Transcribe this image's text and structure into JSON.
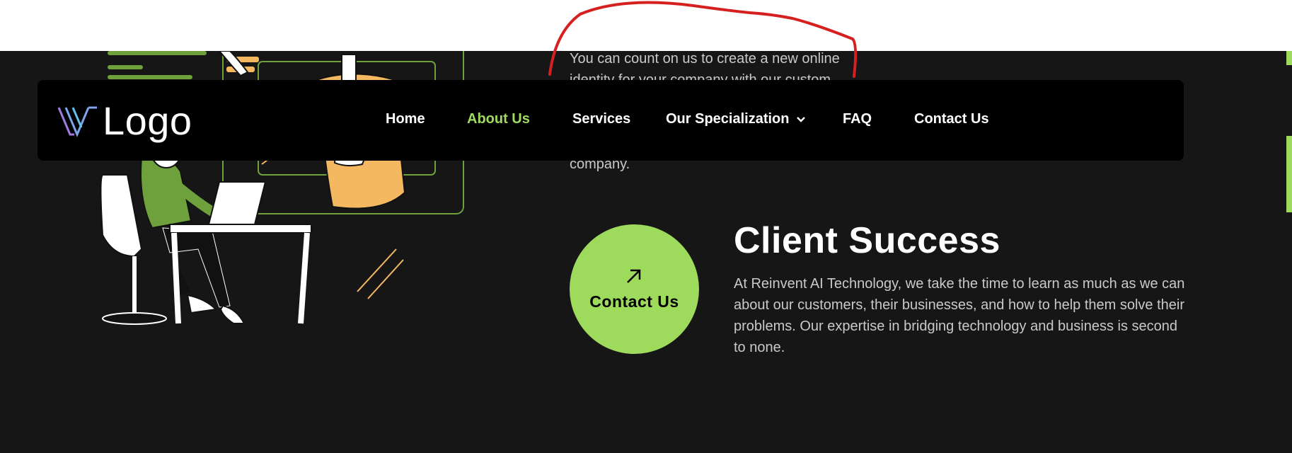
{
  "intro": {
    "text": "You can count on us to create a new online identity for your company with our custom",
    "tail": "company."
  },
  "navbar": {
    "logo_text": "Logo",
    "items": [
      {
        "label": "Home"
      },
      {
        "label": "About Us",
        "active": true
      },
      {
        "label": "Services"
      },
      {
        "label": "Our Specialization"
      },
      {
        "label": "FAQ"
      },
      {
        "label": "Contact Us"
      }
    ]
  },
  "cta": {
    "label": "Contact Us",
    "icon": "arrow-up-right-icon"
  },
  "section": {
    "title": "Client Success",
    "body": "At Reinvent AI Technology, we take the time to learn as much as we can about our customers, their businesses, and how to help them solve their problems. Our expertise in bridging technology and business is second to none."
  },
  "colors": {
    "accent": "#9edb5c",
    "background": "#161616",
    "navbar": "#000000",
    "annotation": "#d62020"
  }
}
